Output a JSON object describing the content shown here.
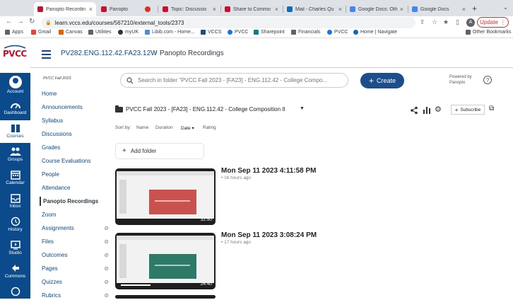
{
  "browser": {
    "tabs": [
      {
        "title": "Panopto Recordin",
        "active": true
      },
      {
        "title": "Panopto",
        "active": false
      },
      {
        "title": "Topic: Discussio",
        "active": false
      },
      {
        "title": "Share to Commo",
        "active": false
      },
      {
        "title": "Mail - Charles Qu",
        "active": false
      },
      {
        "title": "Google Docs: Oth",
        "active": false
      },
      {
        "title": "Google Docs",
        "active": false
      }
    ],
    "url": "learn.vccs.edu/courses/567210/external_tools/2373",
    "avatar_letter": "A",
    "update_label": "Update",
    "bookmarks": [
      "Apps",
      "Gmail",
      "Canvas",
      "Utilities",
      "myUK",
      "Libib.com - Home...",
      "VCCS",
      "PVCC",
      "Sharepoint",
      "Financials",
      "PVCC",
      "Home | Navigate"
    ],
    "other_bookmarks": "Other Bookmarks"
  },
  "global_nav": {
    "logo": "PVCC",
    "items": [
      {
        "label": "Account",
        "icon": "account-icon"
      },
      {
        "label": "Dashboard",
        "icon": "dashboard-icon"
      },
      {
        "label": "Courses",
        "icon": "courses-icon",
        "active": true
      },
      {
        "label": "Groups",
        "icon": "groups-icon"
      },
      {
        "label": "Calendar",
        "icon": "calendar-icon"
      },
      {
        "label": "Inbox",
        "icon": "inbox-icon"
      },
      {
        "label": "History",
        "icon": "history-icon"
      },
      {
        "label": "Studio",
        "icon": "studio-icon"
      },
      {
        "label": "Commons",
        "icon": "commons-icon"
      }
    ]
  },
  "header": {
    "course": "PV282.ENG.112.42.FA23.12W",
    "separator": ">",
    "page": "Panopto Recordings"
  },
  "course_nav": {
    "term": "PVCC Fall 2023",
    "items": [
      {
        "label": "Home"
      },
      {
        "label": "Announcements"
      },
      {
        "label": "Syllabus"
      },
      {
        "label": "Discussions"
      },
      {
        "label": "Grades"
      },
      {
        "label": "Course Evaluations"
      },
      {
        "label": "People"
      },
      {
        "label": "Attendance"
      },
      {
        "label": "Panopto Recordings",
        "active": true
      },
      {
        "label": "Zoom"
      },
      {
        "label": "Assignments",
        "hidden": true
      },
      {
        "label": "Files",
        "hidden": true
      },
      {
        "label": "Outcomes",
        "hidden": true
      },
      {
        "label": "Pages",
        "hidden": true
      },
      {
        "label": "Quizzes",
        "hidden": true
      },
      {
        "label": "Rubrics",
        "hidden": true
      }
    ]
  },
  "panopto": {
    "search_placeholder": "Search in folder \"PVCC Fall 2023 - [FA23] - ENG.112.42 - College Compo...",
    "create_label": "Create",
    "powered_by": "Powered by",
    "powered_brand": "Panopto",
    "folder_name": "PVCC Fall 2023 - [FA23] - ENG.112.42 - College Composition II",
    "subscribe_label": "Subscribe",
    "sort_by": "Sort by:",
    "sort_options": [
      {
        "label": "Name"
      },
      {
        "label": "Duration"
      },
      {
        "label": "Date",
        "selected": true
      },
      {
        "label": "Rating"
      }
    ],
    "add_folder_label": "Add folder",
    "sessions": [
      {
        "title": "Mon Sep 11 2023 4:11:58 PM",
        "meta": "16 hours ago",
        "duration": "32:50",
        "slide_color": "#c9524f"
      },
      {
        "title": "Mon Sep 11 2023 3:08:24 PM",
        "meta": "17 hours ago",
        "duration": "24:40",
        "slide_color": "#2e7a68"
      }
    ]
  }
}
